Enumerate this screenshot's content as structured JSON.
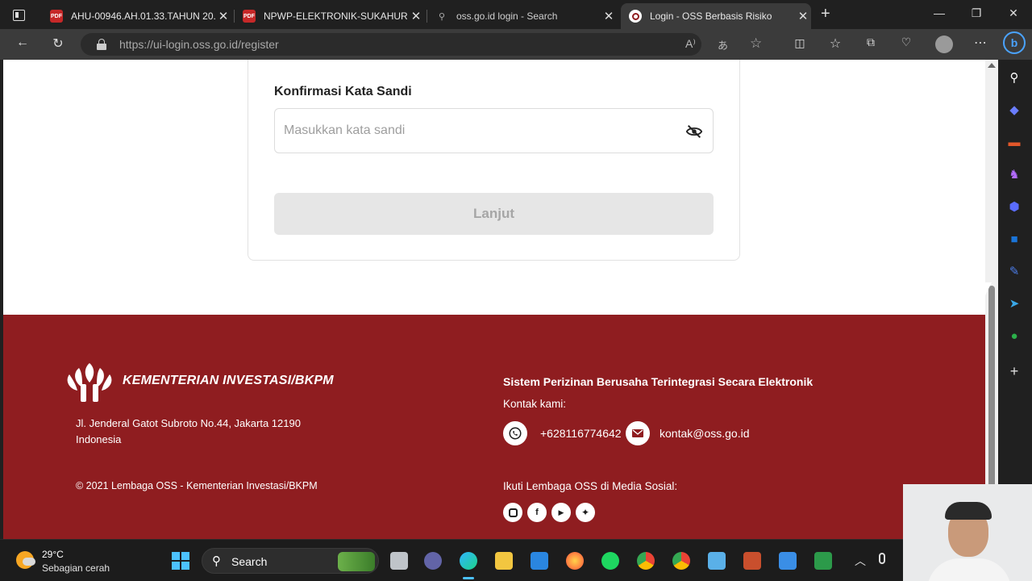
{
  "browser": {
    "tabs": [
      {
        "title": "AHU-00946.AH.01.33.TAHUN 20...",
        "favicon": "pdf-icon",
        "active": false
      },
      {
        "title": "NPWP-ELEKTRONIK-SUKAHURIP...",
        "favicon": "pdf-icon",
        "active": false
      },
      {
        "title": "oss.go.id login - Search",
        "favicon": "search-icon",
        "active": false
      },
      {
        "title": "Login - OSS Berbasis Risiko",
        "favicon": "oss-icon",
        "active": true
      }
    ],
    "new_tab_symbol": "+",
    "url_host": "https://ui-login.oss.go.id",
    "url_path": "/register",
    "pdf_badge": "PDF"
  },
  "form": {
    "confirm_password_label": "Konfirmasi Kata Sandi",
    "confirm_password_placeholder": "Masukkan kata sandi",
    "confirm_password_value": "",
    "submit_label": "Lanjut"
  },
  "footer": {
    "ministry_name": "KEMENTERIAN INVESTASI/BKPM",
    "address_line1": "Jl. Jenderal Gatot Subroto No.44, Jakarta 12190",
    "address_line2": "Indonesia",
    "copyright": "© 2021 Lembaga OSS - Kementerian Investasi/BKPM",
    "system_title": "Sistem Perizinan Berusaha Terintegrasi Secara Elektronik",
    "contact_label": "Kontak kami:",
    "phone": "+628116774642",
    "email": "kontak@oss.go.id",
    "social_label": "Ikuti Lembaga OSS di Media Sosial:",
    "social_icons": [
      "instagram-icon",
      "facebook-icon",
      "youtube-icon",
      "twitter-icon"
    ]
  },
  "taskbar": {
    "temperature": "29°C",
    "weather": "Sebagian cerah",
    "search_label": "Search"
  },
  "colors": {
    "footer_bg": "#8f1d20",
    "button_disabled_bg": "#e6e6e6",
    "browser_chrome": "#3b3b3b"
  }
}
